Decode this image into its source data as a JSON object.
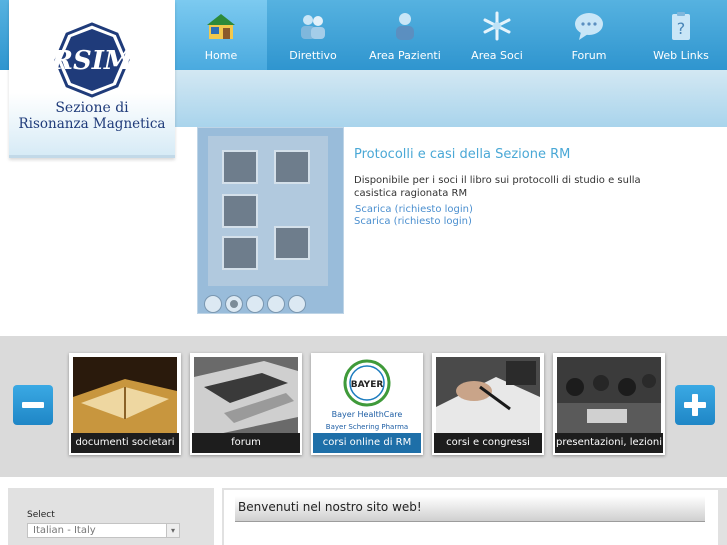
{
  "logo": {
    "monogram": "RSIM",
    "line1": "Sezione di",
    "line2": "Risonanza Magnetica"
  },
  "nav": [
    {
      "label": "Home",
      "icon": "home-icon",
      "active": true
    },
    {
      "label": "Direttivo",
      "icon": "people-icon",
      "active": false
    },
    {
      "label": "Area Pazienti",
      "icon": "patient-icon",
      "active": false
    },
    {
      "label": "Area Soci",
      "icon": "snowflake-icon",
      "active": false
    },
    {
      "label": "Forum",
      "icon": "speech-bubble-icon",
      "active": false
    },
    {
      "label": "Web Links",
      "icon": "question-icon",
      "active": false
    }
  ],
  "slideshow": {
    "title": "Protocolli e casi della Sezione RM",
    "text": "Disponibile per i soci il libro sui protocolli di studio e sulla casistica ragionata  RM",
    "link": "Scarica (richiesto login)",
    "link2": "Scarica (richiesto login)",
    "current_slide": 2,
    "slide_count": 5
  },
  "carousel": {
    "cards": [
      {
        "label": "documenti societari",
        "image": "book-photo"
      },
      {
        "label": "forum",
        "image": "laptop-photo"
      },
      {
        "label": "corsi online di RM",
        "image": "bayer-logo",
        "sponsor_name": "Bayer HealthCare",
        "sponsor_sub": "Bayer Schering Pharma",
        "logo_text": "BAYER"
      },
      {
        "label": "corsi e congressi",
        "image": "writing-photo"
      },
      {
        "label": "presentazioni, lezioni",
        "image": "audience-photo"
      }
    ]
  },
  "language": {
    "label": "Select",
    "value": "Italian - Italy"
  },
  "welcome": {
    "title": "Benvenuti nel nostro sito web!"
  },
  "colors": {
    "header_blue": "#2f95cf",
    "link_blue": "#4b8fcf",
    "logo_navy": "#1f3b7a"
  }
}
